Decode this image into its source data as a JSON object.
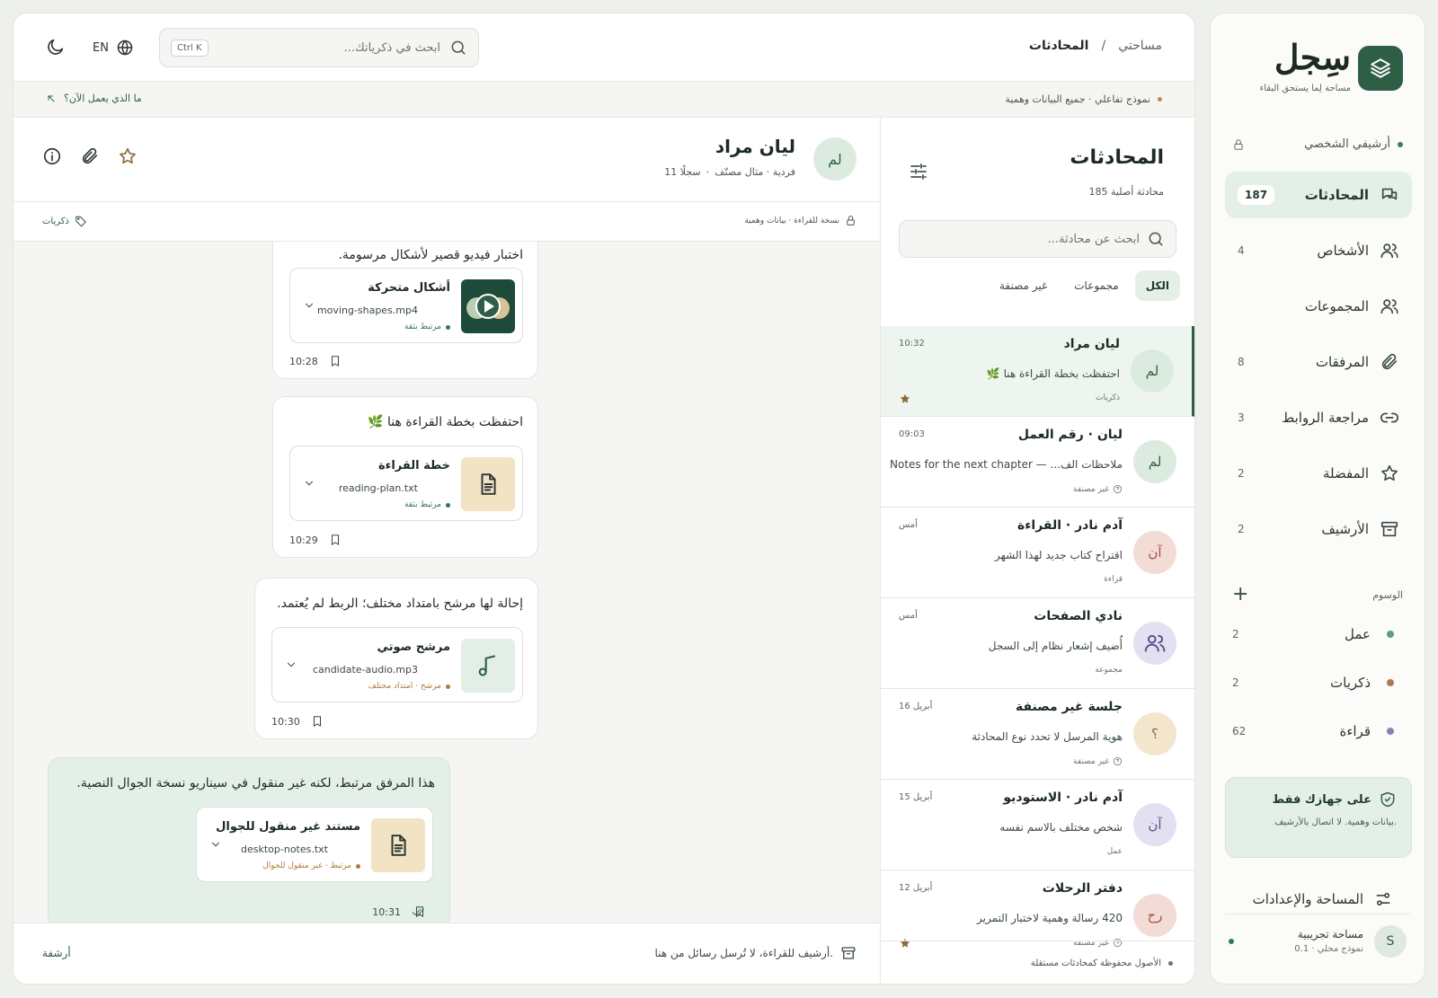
{
  "sidebar": {
    "brand": {
      "title": "سِجل",
      "subtitle": "مساحة لِما يستحق البقاء"
    },
    "personal_archive": "أرشيفي الشخصي",
    "nav": [
      {
        "label": "المحادثات",
        "count": "187",
        "icon": "chat-icon"
      },
      {
        "label": "الأشخاص",
        "count": "4",
        "icon": "people-icon"
      },
      {
        "label": "المجموعات",
        "count": "",
        "icon": "group-icon"
      },
      {
        "label": "المرفقات",
        "count": "8",
        "icon": "paperclip-icon"
      },
      {
        "label": "مراجعة الروابط",
        "count": "3",
        "icon": "link-icon"
      },
      {
        "label": "المفضلة",
        "count": "2",
        "icon": "star-icon"
      },
      {
        "label": "الأرشيف",
        "count": "2",
        "icon": "archive-icon"
      }
    ],
    "tags_heading": "الوسوم",
    "tags": [
      {
        "label": "عمل",
        "count": "2",
        "color": "#5aa07a"
      },
      {
        "label": "ذكريات",
        "count": "2",
        "color": "#b07a4e"
      },
      {
        "label": "قراءة",
        "count": "62",
        "color": "#8b7fb8"
      }
    ],
    "secure": {
      "title": "على جهازك فقط",
      "text": "بيانات وهمية. لا اتصال بالأرشيف."
    },
    "settings_label": "المساحة والإعدادات",
    "workspace": {
      "avatar": "S",
      "name": "مساحة تجريبية",
      "sub": "نموذج محلي · 0.1"
    }
  },
  "topbar": {
    "breadcrumb": [
      "مساحتي",
      "/",
      "المحادثات"
    ],
    "search_placeholder": "ابحث في ذكرياتك...",
    "search_shortcut": "Ctrl K",
    "language": "EN"
  },
  "banner": {
    "notice": "نموذج تفاعلي · جميع البيانات وهمية",
    "link": "ما الذي يعمل الآن؟"
  },
  "conversations": {
    "title": "المحادثات",
    "subtitle": "185 محادثة أصلية",
    "search_placeholder": "ابحث عن محادثة...",
    "tabs": [
      "الكل",
      "مجموعات",
      "غير مصنفة"
    ],
    "items": [
      {
        "initials": "لم",
        "name": "ليان مراد",
        "preview": "احتفظت بخطة القراءة هنا 🌿",
        "tag": "ذكريات",
        "time": "10:32",
        "starred": true
      },
      {
        "initials": "لم",
        "name": "ليان · رقم العمل",
        "preview": "ملاحظات الف... — Notes for the next chapter",
        "tag": "غير مصنفة",
        "time": "09:03",
        "starred": false
      },
      {
        "initials": "آن",
        "name": "آدم نادر · القراءة",
        "preview": "اقتراح كتاب جديد لهذا الشهر",
        "tag": "قراءة",
        "time": "أمس",
        "starred": false
      },
      {
        "initials": "",
        "name": "نادي الصفحات",
        "preview": "أُضيف إشعار نظام إلى السجل",
        "tag": "مجموعة",
        "time": "أمس",
        "starred": false
      },
      {
        "initials": "؟",
        "name": "جلسة غير مصنفة",
        "preview": "هوية المرسل لا تحدد نوع المحادثة",
        "tag": "غير مصنفة",
        "time": "16 أبريل",
        "starred": false
      },
      {
        "initials": "آن",
        "name": "آدم نادر · الاستوديو",
        "preview": "شخص مختلف بالاسم نفسه",
        "tag": "عمل",
        "time": "15 أبريل",
        "starred": false
      },
      {
        "initials": "رح",
        "name": "دفتر الرحلات",
        "preview": "420 رسالة وهمية لاختبار التمرير",
        "tag": "غير مصنفة",
        "time": "12 أبريل",
        "starred": true
      }
    ],
    "footer": "الأصول محفوظة كمحادثات مستقلة"
  },
  "chat": {
    "initials": "لم",
    "name": "ليان مراد",
    "meta": [
      "فردية · مثال مصنّف",
      "·",
      "11 سجلًا"
    ],
    "readonly_note": "نسخة للقراءة · بيانات وهمية",
    "tag": "ذكريات",
    "messages": [
      {
        "text": "اختبار فيديو قصير لأشكال مرسومة.",
        "att_name": "أشكال متحركة",
        "att_file": "moving-shapes.mp4",
        "att_status": "مرتبط بثقة",
        "time": "10:28"
      },
      {
        "text": "احتفظت بخطة القراءة هنا 🌿",
        "att_name": "خطة القراءة",
        "att_file": "reading-plan.txt",
        "att_status": "مرتبط بثقة",
        "time": "10:29"
      },
      {
        "text": "إحالة لها مرشح بامتداد مختلف؛ الربط لم يُعتمد.",
        "att_name": "مرشح صوتي",
        "att_file": "candidate-audio.mp3",
        "att_status": "مرشح · امتداد مختلف",
        "time": "10:30"
      },
      {
        "text": "هذا المرفق مرتبط، لكنه غير منقول في سيناريو نسخة الجوال النصية.",
        "att_name": "مستند غير منقول للجوال",
        "att_file": "desktop-notes.txt",
        "att_status": "مرتبط · غير منقول للجوال",
        "time": "10:31"
      }
    ],
    "footer_note": "أرشيف للقراءة، لا تُرسل رسائل من هنا.",
    "footer_action": "أرشفة"
  },
  "colors": {
    "accent": "#2f5e47",
    "accent_soft": "#e4efe7",
    "warning": "#b07a3a",
    "star": "#8a6a3a"
  }
}
